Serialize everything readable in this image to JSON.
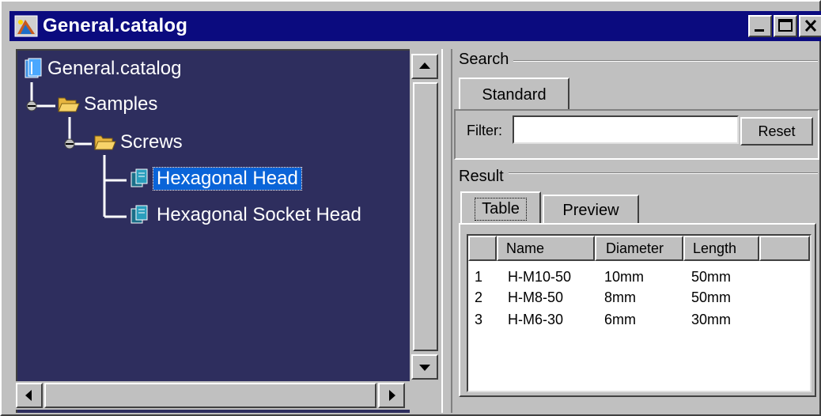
{
  "window": {
    "title": "General.catalog"
  },
  "tree": {
    "root": "General.catalog",
    "items": [
      {
        "label": "Samples"
      },
      {
        "label": "Screws"
      },
      {
        "label": "Hexagonal Head"
      },
      {
        "label": "Hexagonal Socket Head"
      }
    ]
  },
  "search": {
    "group_label": "Search",
    "tab_standard": "Standard",
    "filter_label": "Filter:",
    "filter_value": "",
    "reset_label": "Reset"
  },
  "result": {
    "group_label": "Result",
    "tabs": [
      "Table",
      "Preview"
    ],
    "columns": [
      "Name",
      "Diameter",
      "Length"
    ],
    "rows": [
      {
        "index": "1",
        "name": "H-M10-50",
        "diameter": "10mm",
        "length": "50mm"
      },
      {
        "index": "2",
        "name": "H-M8-50",
        "diameter": "8mm",
        "length": "50mm"
      },
      {
        "index": "3",
        "name": "H-M6-30",
        "diameter": "6mm",
        "length": "30mm"
      }
    ]
  },
  "colors": {
    "titlebar": "#0b0b7f",
    "tree_background": "#2e2e5e",
    "selection": "#0a64d8",
    "chrome": "#c0c0c0"
  }
}
